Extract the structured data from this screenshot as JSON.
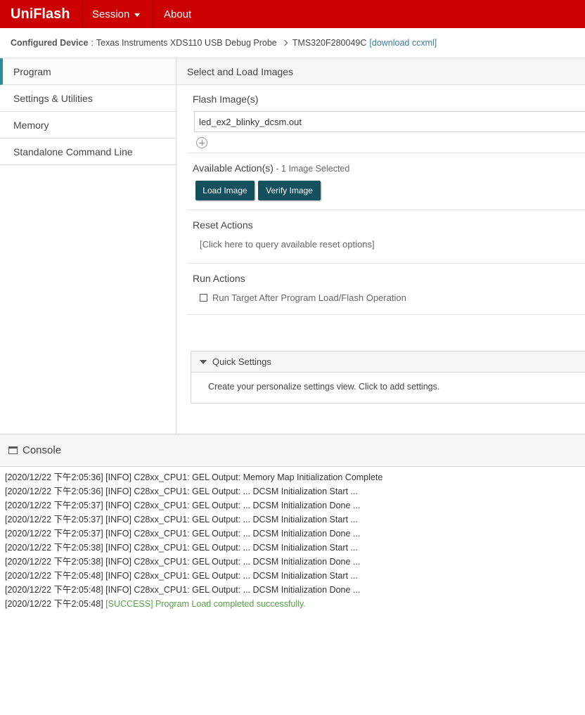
{
  "app": {
    "brand": "UniFlash",
    "menu": {
      "session": "Session",
      "about": "About"
    }
  },
  "breadcrumb": {
    "label": "Configured Device",
    "separator": ":",
    "probe": "Texas Instruments XDS110 USB Debug Probe",
    "device": "TMS320F280049C",
    "download_link": "[download ccxml]"
  },
  "sidebar": {
    "items": [
      {
        "label": "Program"
      },
      {
        "label": "Settings & Utilities"
      },
      {
        "label": "Memory"
      },
      {
        "label": "Standalone Command Line"
      }
    ]
  },
  "main": {
    "header": "Select and Load Images",
    "flash": {
      "title": "Flash Image(s)",
      "value": "led_ex2_blinky_dcsm.out"
    },
    "actions": {
      "title": "Available Action(s)",
      "subtitle": " - 1 Image Selected",
      "load_label": "Load Image",
      "verify_label": "Verify Image"
    },
    "reset": {
      "title": "Reset Actions",
      "query_text": "[Click here to query available reset options]"
    },
    "run": {
      "title": "Run Actions",
      "checkbox_label": "Run Target After Program Load/Flash Operation"
    },
    "quick_settings": {
      "title": "Quick Settings",
      "body": "Create your personalize settings view. Click to add settings."
    }
  },
  "console": {
    "title": "Console",
    "lines": [
      {
        "prefix": "[2020/12/22 下午2:05:36] [INFO] C28xx_CPU1: GEL Output: Memory Map Initialization Complete"
      },
      {
        "prefix": "[2020/12/22 下午2:05:36] [INFO] C28xx_CPU1: GEL Output: ... DCSM Initialization Start ..."
      },
      {
        "prefix": "[2020/12/22 下午2:05:37] [INFO] C28xx_CPU1: GEL Output: ... DCSM Initialization Done ..."
      },
      {
        "prefix": "[2020/12/22 下午2:05:37] [INFO] C28xx_CPU1: GEL Output: ... DCSM Initialization Start ..."
      },
      {
        "prefix": "[2020/12/22 下午2:05:37] [INFO] C28xx_CPU1: GEL Output: ... DCSM Initialization Done ..."
      },
      {
        "prefix": "[2020/12/22 下午2:05:38] [INFO] C28xx_CPU1: GEL Output: ... DCSM Initialization Start ..."
      },
      {
        "prefix": "[2020/12/22 下午2:05:38] [INFO] C28xx_CPU1: GEL Output: ... DCSM Initialization Done ..."
      },
      {
        "prefix": "[2020/12/22 下午2:05:48] [INFO] C28xx_CPU1: GEL Output: ... DCSM Initialization Start ..."
      },
      {
        "prefix": "[2020/12/22 下午2:05:48] [INFO] C28xx_CPU1: GEL Output: ... DCSM Initialization Done ..."
      },
      {
        "prefix": "[2020/12/22 下午2:05:48] ",
        "success": "[SUCCESS] Program Load completed successfully."
      }
    ]
  }
}
